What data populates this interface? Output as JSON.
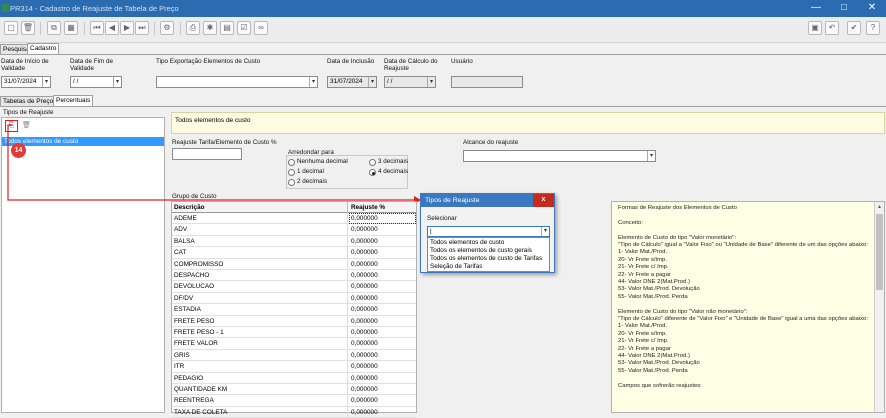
{
  "window": {
    "title": "PR314 - Cadastro de Reajuste de Tabela de Preço",
    "min": "—",
    "max": "□",
    "close": "✕"
  },
  "top_tabs": [
    "Pesquisa",
    "Cadastro"
  ],
  "form": {
    "fields": [
      {
        "label": "Data de Início de\nValidade",
        "value": "31/07/2024"
      },
      {
        "label": "Data de Fim de\nValidade",
        "value": "/ /"
      },
      {
        "label": "Tipo Exportação Elementos de Custo",
        "value": ""
      },
      {
        "label": "Data de Inclusão",
        "value": "31/07/2024"
      },
      {
        "label": "Data de Cálculo do\nReajuste",
        "value": "/ /"
      },
      {
        "label": "Usuário",
        "value": ""
      }
    ]
  },
  "sub_tabs": [
    "Tabelas de Preço",
    "Percentuais"
  ],
  "tipos": {
    "title": "Tipos de Reajuste",
    "items": [
      "Todos elementos de custo"
    ],
    "badge": "14"
  },
  "banner": "Todos elementos de custo",
  "reajuste": {
    "label": "Reajuste Tarifa/Elemento de Custo %",
    "value": ""
  },
  "arredondar": {
    "label": "Arredondar para",
    "options": [
      "Nenhuma decimal",
      "3 decimais",
      "1 decimal",
      "4 decimais",
      "2 decimais"
    ],
    "selected": "4 decimais"
  },
  "alcance": {
    "label": "Alcance do reajuste",
    "value": ""
  },
  "grupo_label": "Grupo de Custo",
  "table": {
    "headers": [
      "Descrição",
      "Reajuste %"
    ],
    "rows": [
      [
        "ADEME",
        "0,000000"
      ],
      [
        "ADV",
        "0,000000"
      ],
      [
        "BALSA",
        "0,000000"
      ],
      [
        "CAT",
        "0,000000"
      ],
      [
        "COMPROMISSO",
        "0,000000"
      ],
      [
        "DESPACHO",
        "0,000000"
      ],
      [
        "DEVOLUCAO",
        "0,000000"
      ],
      [
        "DF/DV",
        "0,000000"
      ],
      [
        "ESTADIA",
        "0,000000"
      ],
      [
        "FRETE PESO",
        "0,000000"
      ],
      [
        "FRETE PESO - 1",
        "0,000000"
      ],
      [
        "FRETE VALOR",
        "0,000000"
      ],
      [
        "GRIS",
        "0,000000"
      ],
      [
        "ITR",
        "0,000000"
      ],
      [
        "PEDAGIO",
        "0,000000"
      ],
      [
        "QUANTIDADE KM",
        "0,000000"
      ],
      [
        "REENTREGA",
        "0,000000"
      ],
      [
        "TAXA DE COLETA",
        "0,000000"
      ]
    ]
  },
  "dialog": {
    "title": "Tipos de Reajuste",
    "close": "x",
    "select_label": "Selecionar",
    "value": "|",
    "options": [
      "Todos elementos de custo",
      "Todos os elementos de custo gerais",
      "Todos os elementos de custo de Tarifas",
      "Seleção de Tarifas"
    ]
  },
  "help": {
    "lines": [
      "Formas de Reajuste dos Elementos de Custo",
      "",
      "Conceito:",
      "",
      "Elemento de Custo do tipo \"Valor monetário\":",
      "\"Tipo de Cálculo\" igual a \"Valor Fixo\" ou \"Unidade de Base\" diferente de um das opções abaixo:",
      "1- Valor Mat./Prod.",
      "20- Vr Frete s/Imp.",
      "21- Vr Frete c/ Imp.",
      "22- Vr Frete a pagar",
      "44- Valor DNE 2(Mat.Prod.)",
      "53- Valor Mat./Prod. Devolução",
      "55- Valor Mat./Prod. Perda",
      "",
      "Elemento de Custo do tipo \"Valor não monetário\":",
      "\"Tipo de Cálculo\" diferente de \"Valor Fixo\" e \"Unidade de Base\" igual a uma das opções abaixo:",
      "1- Valor Mat./Prod.",
      "20- Vr Frete s/Imp.",
      "21- Vr Frete c/ Imp.",
      "22- Vr Frete a pagar",
      "44- Valor DNE 2(Mat.Prod.)",
      "53- Valor Mat./Prod. Devolução",
      "55- Valor Mat./Prod. Perda",
      "",
      "Campos que sofrerão reajustes:"
    ]
  },
  "colors": {
    "title": "#2b6cb0",
    "dialog_title": "#3a78c2",
    "dialog_close": "#c42b1c",
    "banner": "#fffbe0",
    "help_bg": "#ffffe6",
    "highlight": "#3399ff",
    "arrow": "#e02020",
    "badge": "#e53935"
  }
}
